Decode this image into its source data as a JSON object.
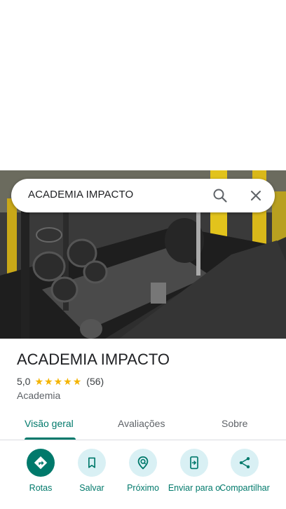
{
  "search": {
    "query": "ACADEMIA IMPACTO"
  },
  "place": {
    "title": "ACADEMIA IMPACTO",
    "rating": "5,0",
    "stars": 5,
    "review_count": "(56)",
    "category": "Academia"
  },
  "tabs": [
    {
      "label": "Visão geral",
      "active": true
    },
    {
      "label": "Avaliações",
      "active": false
    },
    {
      "label": "Sobre",
      "active": false
    }
  ],
  "actions": [
    {
      "label": "Rotas",
      "icon": "directions-icon"
    },
    {
      "label": "Salvar",
      "icon": "bookmark-icon"
    },
    {
      "label": "Próximo",
      "icon": "nearby-icon"
    },
    {
      "label": "Enviar para o",
      "icon": "send-to-phone-icon"
    },
    {
      "label": "Compartilhar",
      "icon": "share-icon"
    }
  ],
  "colors": {
    "accent": "#00796b",
    "action_bg": "#d9f0f4",
    "star": "#f4b400"
  }
}
